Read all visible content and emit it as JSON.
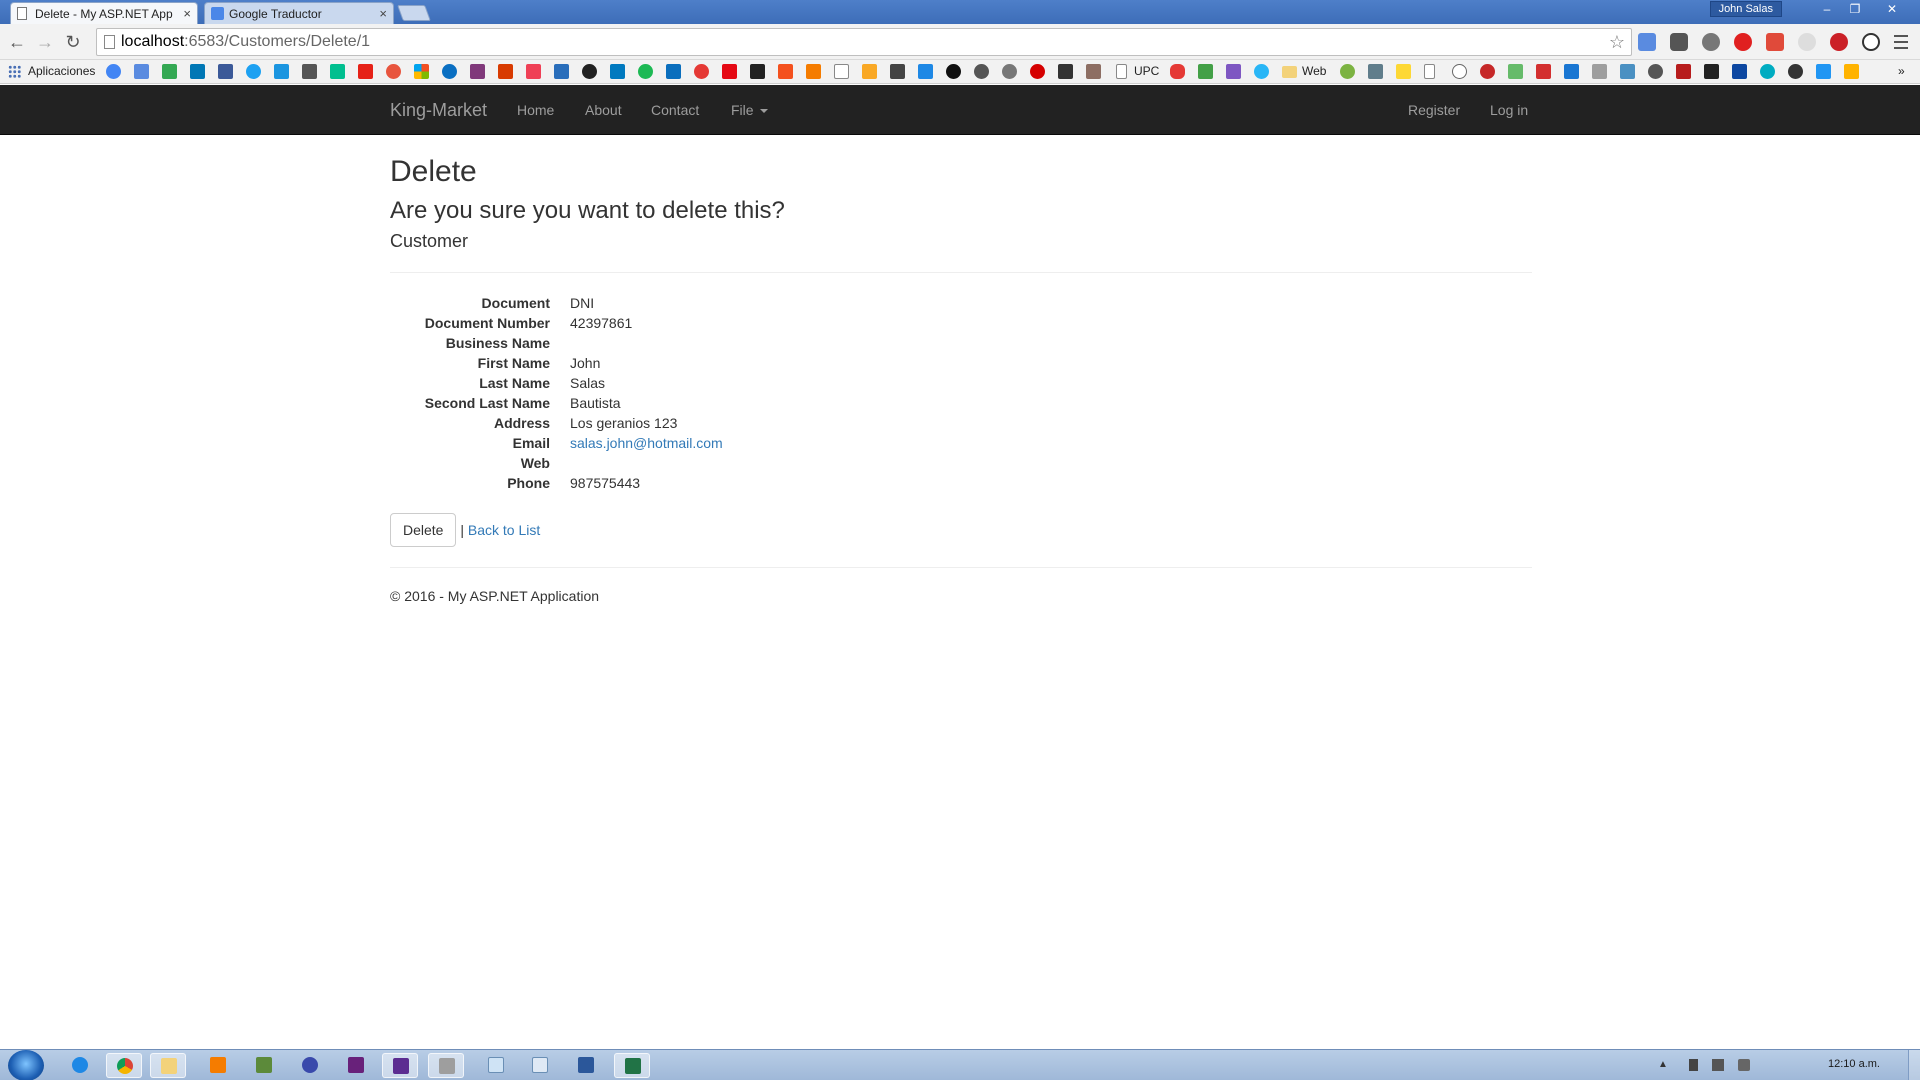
{
  "browser": {
    "tabs": [
      {
        "label": "Delete - My ASP.NET App",
        "active": true
      },
      {
        "label": "Google Traductor",
        "active": false
      }
    ],
    "user": "John Salas",
    "url_host": "localhost",
    "url_path": ":6583/Customers/Delete/1",
    "bookmarks": {
      "apps_label": "Aplicaciones",
      "upc_label": "UPC",
      "web_label": "Web"
    }
  },
  "navbar": {
    "brand": "King-Market",
    "links": [
      "Home",
      "About",
      "Contact",
      "File"
    ],
    "right_links": [
      "Register",
      "Log in"
    ]
  },
  "page": {
    "title": "Delete",
    "question": "Are you sure you want to delete this?",
    "entity": "Customer",
    "fields": [
      {
        "label": "Document",
        "value": "DNI"
      },
      {
        "label": "Document Number",
        "value": "42397861"
      },
      {
        "label": "Business Name",
        "value": ""
      },
      {
        "label": "First Name",
        "value": "John"
      },
      {
        "label": "Last Name",
        "value": "Salas"
      },
      {
        "label": "Second Last Name",
        "value": "Bautista"
      },
      {
        "label": "Address",
        "value": "Los geranios 123"
      },
      {
        "label": "Email",
        "value": "salas.john@hotmail.com"
      },
      {
        "label": "Web",
        "value": ""
      },
      {
        "label": "Phone",
        "value": "987575443"
      }
    ],
    "delete_button": "Delete",
    "separator": "|",
    "back_link": "Back to List",
    "footer": "© 2016 - My ASP.NET Application"
  },
  "taskbar": {
    "clock": "12:10 a.m."
  },
  "colors": {
    "navbar_bg": "#222222",
    "navbar_text": "#9d9d9d",
    "link": "#337ab7"
  }
}
